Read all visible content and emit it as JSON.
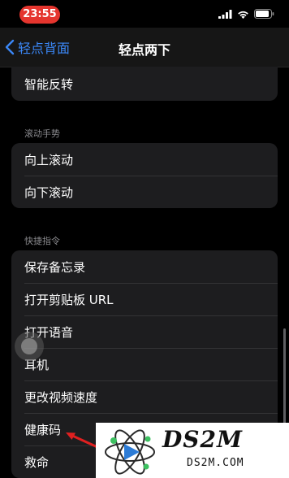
{
  "status_bar": {
    "time": "23:55"
  },
  "nav": {
    "back_label": "轻点背面",
    "title": "轻点两下"
  },
  "top_group": {
    "items": [
      "智能反转"
    ]
  },
  "scroll_section": {
    "header": "滚动手势",
    "items": [
      "向上滚动",
      "向下滚动"
    ]
  },
  "shortcut_section": {
    "header": "快捷指令",
    "items": [
      "保存备忘录",
      "打开剪贴板 URL",
      "打开语音",
      "耳机",
      "更改视频速度",
      "健康码",
      "救命"
    ]
  },
  "watermark": {
    "brand": "DS2M",
    "domain": "DS2M.COM"
  },
  "colors": {
    "accent": "#3b87f6",
    "time_pill": "#e5352e",
    "annotation_arrow": "#e02020"
  }
}
